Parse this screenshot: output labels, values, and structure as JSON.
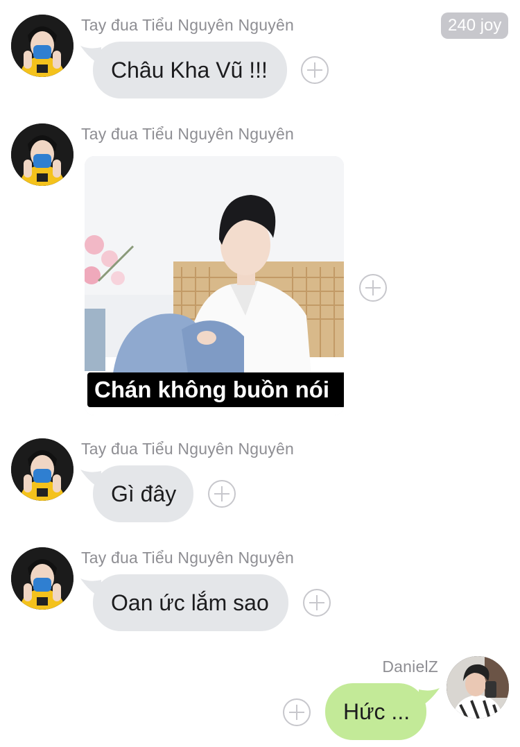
{
  "header": {
    "badge": "240 joy"
  },
  "messages": [
    {
      "sender": "Tay đua Tiểu Nguyên Nguyên",
      "text": "Châu Kha Vũ !!!"
    },
    {
      "sender": "Tay đua Tiểu Nguyên Nguyên",
      "image_caption": "Chán không buồn nói"
    },
    {
      "sender": "Tay đua Tiểu Nguyên Nguyên",
      "text": "Gì đây"
    },
    {
      "sender": "Tay đua Tiểu Nguyên Nguyên",
      "text": "Oan ức lắm sao"
    },
    {
      "sender": "DanielZ",
      "text": "Hức ..."
    }
  ],
  "colors": {
    "incoming_bubble": "#e4e6e9",
    "outgoing_bubble": "#c3ea98",
    "sender_text": "#8e8e93"
  },
  "icons": {
    "add_reaction": "plus-circle-icon"
  }
}
